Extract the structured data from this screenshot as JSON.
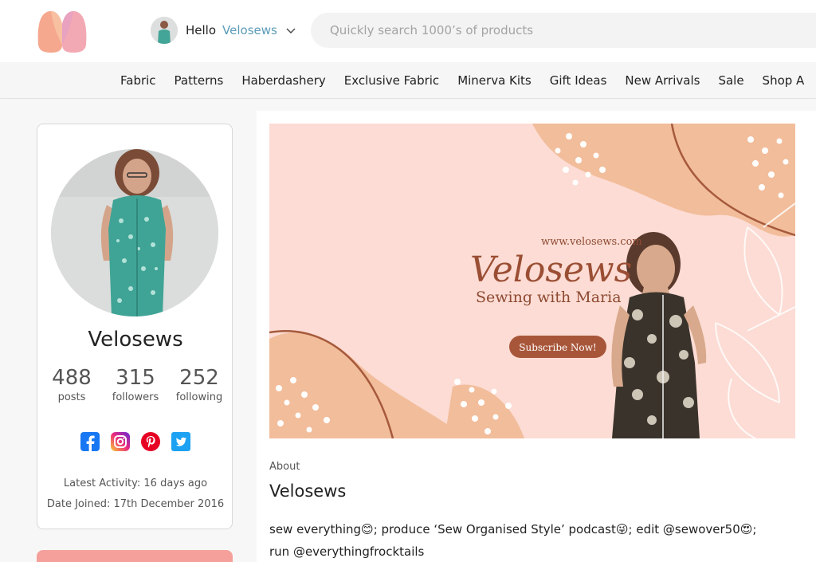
{
  "header": {
    "greeting": "Hello",
    "username": "Velosews",
    "search_placeholder": "Quickly search 1000’s of products",
    "logo_icon": "minerva-logo-icon",
    "brand_colors": {
      "peach": "#f6b39a",
      "pink": "#e7a3b6",
      "accent_blue": "#5b9bb8"
    }
  },
  "nav": {
    "items": [
      "Fabric",
      "Patterns",
      "Haberdashery",
      "Exclusive Fabric",
      "Minerva Kits",
      "Gift Ideas",
      "New Arrivals",
      "Sale",
      "Shop A"
    ]
  },
  "profile": {
    "name": "Velosews",
    "stats": [
      {
        "value": "488",
        "label": "posts"
      },
      {
        "value": "315",
        "label": "followers"
      },
      {
        "value": "252",
        "label": "following"
      }
    ],
    "socials": [
      "facebook-icon",
      "instagram-icon",
      "pinterest-icon",
      "twitter-icon"
    ],
    "latest_activity": "Latest Activity: 16 days ago",
    "date_joined": "Date Joined: 17th December 2016"
  },
  "banner": {
    "url": "www.velosews.com",
    "title": "Velosews",
    "subtitle": "Sewing with Maria",
    "cta": "Subscribe Now!"
  },
  "about": {
    "label": "About",
    "name": "Velosews",
    "bio_line1": "sew everything",
    "bio_line1b": "; produce ‘Sew Organised Style’ podcast",
    "bio_line1c": "; edit @sewover50",
    "bio_line1d": ";",
    "bio_line2": "run @everythingfrocktails",
    "emoji_1": "😊",
    "emoji_2": "😜",
    "emoji_3": "😍"
  }
}
